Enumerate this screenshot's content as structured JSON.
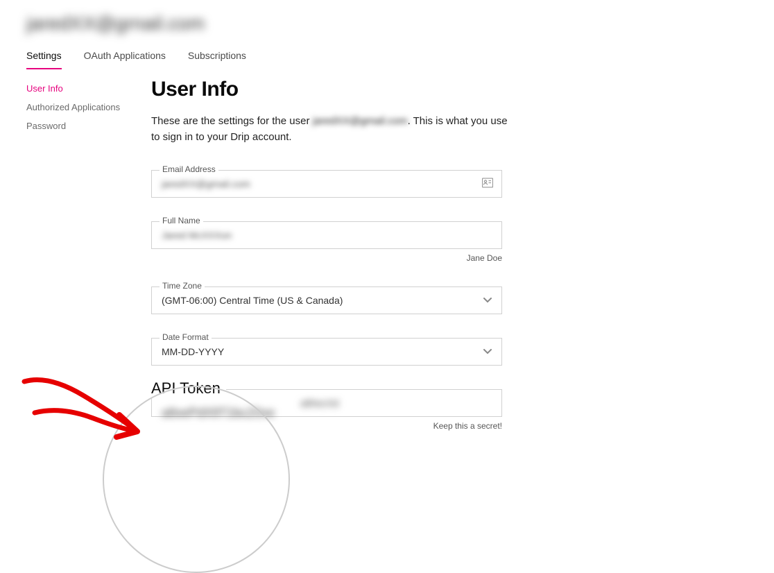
{
  "header": {
    "email_redacted": "jaredXX@grnail.com"
  },
  "tabs": [
    {
      "label": "Settings",
      "active": true
    },
    {
      "label": "OAuth Applications",
      "active": false
    },
    {
      "label": "Subscriptions",
      "active": false
    }
  ],
  "sidebar": [
    {
      "label": "User Info",
      "active": true
    },
    {
      "label": "Authorized Applications",
      "active": false
    },
    {
      "label": "Password",
      "active": false
    }
  ],
  "main": {
    "title": "User Info",
    "description_pre": "These are the settings for the user ",
    "description_user_redacted": "jaredXX@gmail.com",
    "description_post": ". This is what you use to sign in to your Drip account.",
    "fields": {
      "email": {
        "label": "Email Address",
        "value_redacted": "jaredXX@gmail.com"
      },
      "fullname": {
        "label": "Full Name",
        "value_redacted": "Jared McXXXon",
        "helper": "Jane Doe"
      },
      "timezone": {
        "label": "Time Zone",
        "value": "(GMT-06:00) Central Time (US & Canada)"
      },
      "dateformat": {
        "label": "Date Format",
        "value": "MM-DD-YYYY"
      },
      "apitoken": {
        "label": "API Token",
        "value_redacted": "a8xePdX9T1bcZ0xe",
        "helper": "Keep this a secret!"
      }
    }
  }
}
